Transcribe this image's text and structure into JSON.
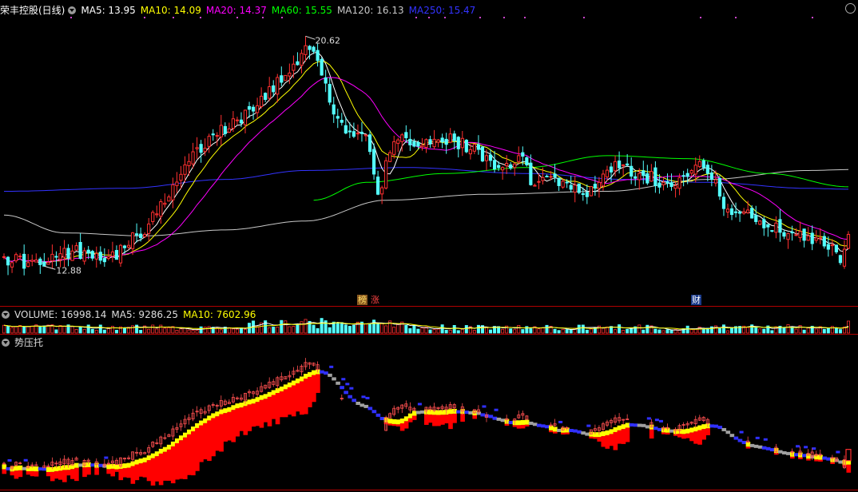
{
  "main": {
    "title": "荣丰控股(日线)",
    "ma": [
      {
        "label": "MA5: 13.95",
        "color": "#ffffff"
      },
      {
        "label": "MA10: 14.09",
        "color": "#ffff00"
      },
      {
        "label": "MA20: 14.37",
        "color": "#ff00ff"
      },
      {
        "label": "MA60: 15.55",
        "color": "#00ff00"
      },
      {
        "label": "MA120: 16.13",
        "color": "#c8c8c8"
      },
      {
        "label": "MA250: 15.47",
        "color": "#3333ff"
      }
    ],
    "high_label": "20.62",
    "low_label": "12.88",
    "markers": [
      {
        "text": "榜",
        "bg": "#8a5a20",
        "color": "#ffdd66"
      },
      {
        "text": "涨",
        "bg": "#000000",
        "color": "#ff4444"
      },
      {
        "text": "财",
        "bg": "#1a3a8a",
        "color": "#ffffff"
      }
    ]
  },
  "volume_panel": {
    "items": [
      {
        "label": "VOLUME: 16998.14",
        "color": "#dddddd"
      },
      {
        "label": "MA5: 9286.25",
        "color": "#dddddd"
      },
      {
        "label": "MA10: 7602.96",
        "color": "#ffff00"
      }
    ]
  },
  "indicator_panel": {
    "title": "势压托"
  },
  "colors": {
    "up": "#ff3030",
    "down": "#54ffff",
    "ma5": "#ffffff",
    "ma10": "#ffff00",
    "ma20": "#ff00ff",
    "ma60": "#00ff00",
    "ma120": "#c8c8c8",
    "ma250": "#3333ff",
    "separator": "#b00000",
    "pressure": "#3030ff",
    "neutral": "#a0a0a0",
    "support_band": "#ffff00",
    "support_fill": "#ff0000"
  },
  "chart_data": {
    "type": "candlestick",
    "y_range": [
      12.0,
      21.3
    ],
    "highest": 20.62,
    "lowest": 12.88,
    "anchors": [
      [
        0,
        13.2
      ],
      [
        6,
        13.0
      ],
      [
        10,
        12.88
      ],
      [
        14,
        13.3
      ],
      [
        20,
        13.4
      ],
      [
        26,
        13.2
      ],
      [
        30,
        13.5
      ],
      [
        36,
        14.3
      ],
      [
        40,
        15.0
      ],
      [
        46,
        16.4
      ],
      [
        52,
        17.3
      ],
      [
        58,
        17.8
      ],
      [
        64,
        18.6
      ],
      [
        70,
        19.3
      ],
      [
        75,
        20.3
      ],
      [
        78,
        19.8
      ],
      [
        82,
        18.0
      ],
      [
        86,
        17.4
      ],
      [
        90,
        17.3
      ],
      [
        93,
        15.3
      ],
      [
        96,
        16.7
      ],
      [
        100,
        17.2
      ],
      [
        106,
        17.0
      ],
      [
        112,
        17.1
      ],
      [
        116,
        16.8
      ],
      [
        120,
        16.6
      ],
      [
        124,
        16.2
      ],
      [
        128,
        16.6
      ],
      [
        132,
        15.6
      ],
      [
        136,
        15.9
      ],
      [
        140,
        15.7
      ],
      [
        144,
        15.3
      ],
      [
        148,
        15.7
      ],
      [
        152,
        16.4
      ],
      [
        158,
        16.0
      ],
      [
        164,
        15.7
      ],
      [
        170,
        15.9
      ],
      [
        173,
        16.4
      ],
      [
        176,
        15.8
      ],
      [
        180,
        14.8
      ],
      [
        186,
        14.5
      ],
      [
        190,
        14.2
      ],
      [
        196,
        14.0
      ],
      [
        200,
        13.9
      ],
      [
        206,
        13.6
      ],
      [
        208,
        13.0
      ],
      [
        210,
        13.95
      ]
    ],
    "ma_lines": {
      "ma60": [
        [
          77,
          15.1
        ],
        [
          90,
          15.7
        ],
        [
          110,
          16.0
        ],
        [
          130,
          16.2
        ],
        [
          150,
          16.6
        ],
        [
          170,
          16.5
        ],
        [
          190,
          16.0
        ],
        [
          210,
          15.55
        ]
      ],
      "ma120": [
        [
          0,
          14.6
        ],
        [
          15,
          14.0
        ],
        [
          35,
          13.9
        ],
        [
          55,
          14.1
        ],
        [
          75,
          14.4
        ],
        [
          95,
          15.1
        ],
        [
          120,
          15.3
        ],
        [
          150,
          15.4
        ],
        [
          175,
          15.8
        ],
        [
          200,
          16.1
        ],
        [
          210,
          16.13
        ]
      ],
      "ma250": [
        [
          0,
          15.4
        ],
        [
          30,
          15.5
        ],
        [
          55,
          15.8
        ],
        [
          75,
          16.1
        ],
        [
          100,
          16.2
        ],
        [
          130,
          16.0
        ],
        [
          155,
          15.8
        ],
        [
          175,
          15.7
        ],
        [
          200,
          15.5
        ],
        [
          210,
          15.47
        ]
      ]
    },
    "volume": {
      "last": 16998.14,
      "ma5": 9286.25,
      "ma10": 7602.96
    },
    "indicator": {
      "y_range": [
        11.4,
        21.3
      ]
    }
  }
}
